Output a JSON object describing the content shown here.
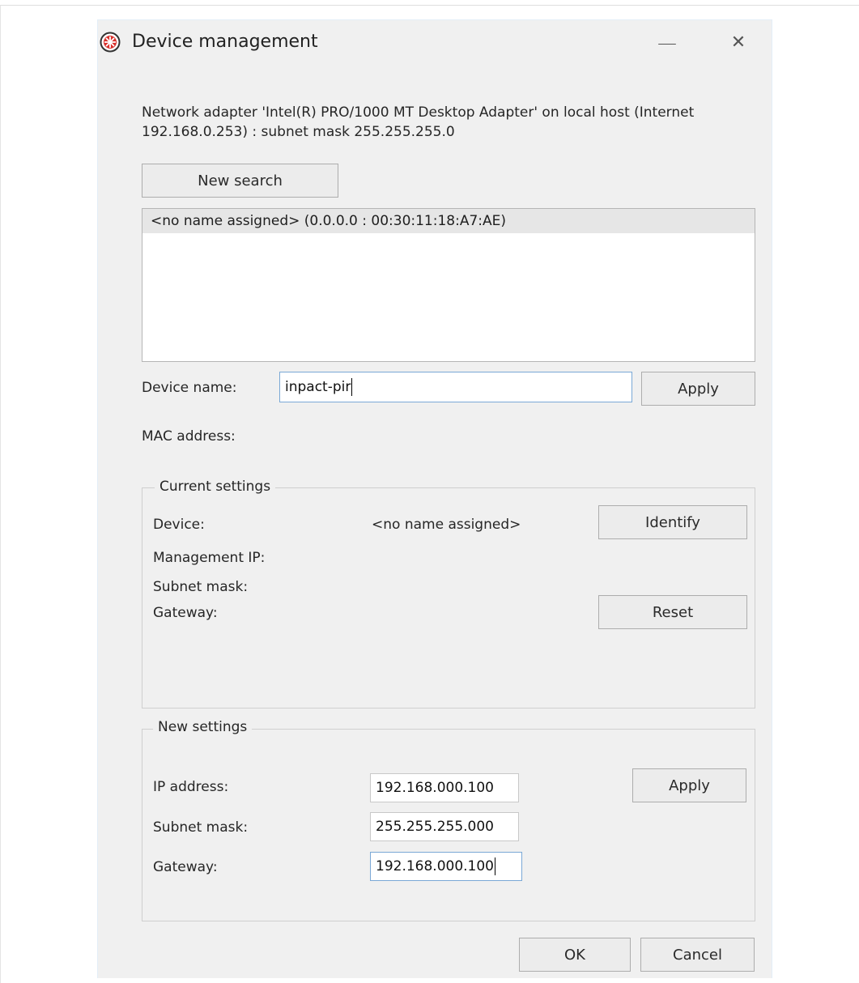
{
  "window": {
    "title": "Device management",
    "minimize_glyph": "—",
    "close_glyph": "✕"
  },
  "adapter": {
    "info_line1": "Network adapter 'Intel(R) PRO/1000 MT Desktop Adapter' on local host (Internet",
    "info_line2": "192.168.0.253) : subnet mask 255.255.255.0"
  },
  "search": {
    "button_label": "New search"
  },
  "device_list": {
    "items": [
      "<no name assigned> (0.0.0.0 : 00:30:11:18:A7:AE)"
    ]
  },
  "device_name": {
    "label": "Device name:",
    "value": "inpact-pir",
    "apply_label": "Apply"
  },
  "mac": {
    "label": "MAC address:"
  },
  "current_settings": {
    "title": "Current settings",
    "device_label": "Device:",
    "device_value": "<no name assigned>",
    "identify_label": "Identify",
    "mgmt_ip_label": "Management IP:",
    "subnet_label": "Subnet mask:",
    "gateway_label": "Gateway:",
    "reset_label": "Reset"
  },
  "new_settings": {
    "title": "New settings",
    "ip_label": "IP address:",
    "ip_value": "192.168.000.100",
    "subnet_label": "Subnet mask:",
    "subnet_value": "255.255.255.000",
    "gateway_label": "Gateway:",
    "gateway_value": "192.168.000.100",
    "apply_label": "Apply"
  },
  "footer": {
    "ok_label": "OK",
    "cancel_label": "Cancel"
  },
  "icons": {
    "app": "app-logo-icon",
    "minimize": "minimize-icon",
    "close": "close-icon"
  },
  "colors": {
    "dialog_bg": "#f0f0f0",
    "logo_red": "#d9302c",
    "focus_border": "#7aa8d6"
  }
}
